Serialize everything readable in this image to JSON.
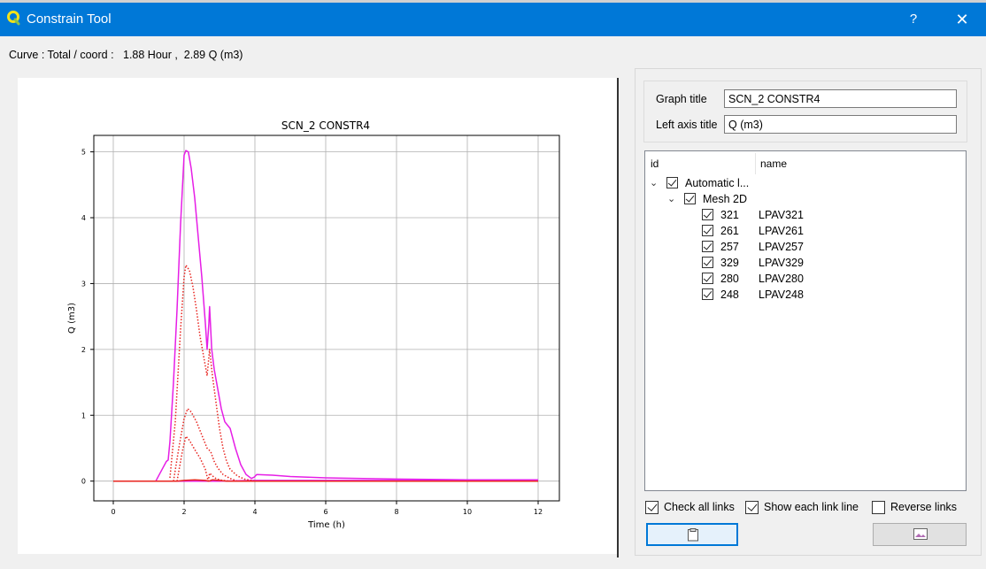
{
  "window": {
    "title": "Constrain Tool",
    "help_label": "?",
    "close_label": "✕",
    "icon": "qgis-icon"
  },
  "curve_info": "Curve : Total / coord :   1.88 Hour ,  2.89 Q (m3)",
  "settings": {
    "graph_title_label": "Graph title",
    "graph_title_value": "SCN_2 CONSTR4",
    "left_axis_label": "Left axis title",
    "left_axis_value": "Q (m3)"
  },
  "tree": {
    "col_id": "id",
    "col_name": "name",
    "root": {
      "label": "Automatic l...",
      "checked": true
    },
    "group": {
      "label": "Mesh 2D",
      "checked": true
    },
    "links": [
      {
        "id": "321",
        "name": "LPAV321",
        "checked": true
      },
      {
        "id": "261",
        "name": "LPAV261",
        "checked": true
      },
      {
        "id": "257",
        "name": "LPAV257",
        "checked": true
      },
      {
        "id": "329",
        "name": "LPAV329",
        "checked": true
      },
      {
        "id": "280",
        "name": "LPAV280",
        "checked": true
      },
      {
        "id": "248",
        "name": "LPAV248",
        "checked": true
      }
    ]
  },
  "options": {
    "check_all": {
      "label": "Check all links",
      "checked": true
    },
    "show_each": {
      "label": "Show each link line",
      "checked": true
    },
    "reverse": {
      "label": "Reverse links",
      "checked": false
    }
  },
  "buttons": {
    "copy_icon": "clipboard-icon",
    "image_icon": "image-icon"
  },
  "chart_data": {
    "type": "line",
    "title": "SCN_2 CONSTR4",
    "xlabel": "Time (h)",
    "ylabel": "Q (m3)",
    "xlim": [
      -0.55,
      12.6
    ],
    "ylim": [
      -0.3,
      5.25
    ],
    "xticks": [
      0,
      2,
      4,
      6,
      8,
      10,
      12
    ],
    "yticks": [
      0,
      1,
      2,
      3,
      4,
      5
    ],
    "grid": true,
    "series": [
      {
        "color": "#e61ee6",
        "style": "solid",
        "x": [
          0,
          1.2,
          1.4,
          1.5,
          1.55,
          1.6,
          1.7,
          1.8,
          1.9,
          2.0,
          2.05,
          2.12,
          2.2,
          2.3,
          2.4,
          2.5,
          2.6,
          2.65,
          2.7,
          2.72,
          2.78,
          2.85,
          2.95,
          3.05,
          3.15,
          3.3,
          3.45,
          3.6,
          3.75,
          3.9,
          3.98,
          4.05,
          4.5,
          5,
          6,
          8,
          10,
          12
        ],
        "y": [
          0,
          0,
          0.2,
          0.3,
          0.32,
          0.6,
          1.5,
          2.6,
          3.9,
          4.95,
          5.02,
          5.0,
          4.75,
          4.3,
          3.7,
          3.1,
          2.4,
          2.0,
          2.4,
          2.65,
          2.0,
          1.7,
          1.4,
          1.1,
          0.9,
          0.8,
          0.5,
          0.25,
          0.1,
          0.04,
          0.06,
          0.1,
          0.09,
          0.07,
          0.05,
          0.03,
          0.02,
          0.02
        ]
      },
      {
        "color": "#e61ee6",
        "style": "solid",
        "x": [
          0,
          1.2,
          2,
          3,
          4,
          6,
          8,
          10,
          12
        ],
        "y": [
          0,
          0,
          0,
          0,
          0.01,
          0.01,
          0.01,
          0.01,
          0.01
        ]
      },
      {
        "color": "#e8231e",
        "style": "dotted",
        "x": [
          1.6,
          1.75,
          1.9,
          2.0,
          2.05,
          2.15,
          2.25,
          2.35,
          2.45,
          2.55,
          2.65,
          2.72,
          2.8,
          2.9,
          3.0,
          3.1,
          3.2,
          3.3,
          3.5,
          3.7,
          4
        ],
        "y": [
          0.05,
          0.9,
          2.3,
          3.1,
          3.28,
          3.2,
          2.95,
          2.6,
          2.2,
          1.9,
          1.6,
          2.0,
          1.6,
          1.2,
          0.8,
          0.5,
          0.3,
          0.18,
          0.08,
          0.03,
          0
        ]
      },
      {
        "color": "#e8231e",
        "style": "dotted",
        "x": [
          1.7,
          1.85,
          2.0,
          2.1,
          2.2,
          2.35,
          2.5,
          2.65,
          2.75,
          2.85,
          2.95,
          3.1,
          3.3,
          3.5
        ],
        "y": [
          0,
          0.5,
          0.95,
          1.1,
          1.05,
          0.9,
          0.7,
          0.5,
          0.45,
          0.3,
          0.2,
          0.1,
          0.04,
          0
        ]
      },
      {
        "color": "#e8231e",
        "style": "dotted",
        "x": [
          1.8,
          1.95,
          2.05,
          2.15,
          2.3,
          2.45,
          2.6,
          2.68,
          2.72,
          2.8,
          2.9,
          3.0,
          3.1,
          3.3
        ],
        "y": [
          0,
          0.45,
          0.68,
          0.62,
          0.48,
          0.35,
          0.18,
          0.0,
          0.12,
          0.08,
          0.04,
          0.02,
          0.01,
          0
        ]
      },
      {
        "color": "#e8231e",
        "style": "solid",
        "x": [
          0,
          1.8,
          2.0,
          2.3,
          2.6,
          2.7,
          2.8,
          3.0,
          3.2,
          4,
          6,
          8,
          10,
          12
        ],
        "y": [
          0,
          0,
          0.01,
          0.02,
          0.01,
          0.0,
          0.02,
          0.01,
          0.0,
          0.0,
          0.0,
          0.0,
          0.0,
          0.0
        ]
      }
    ]
  }
}
